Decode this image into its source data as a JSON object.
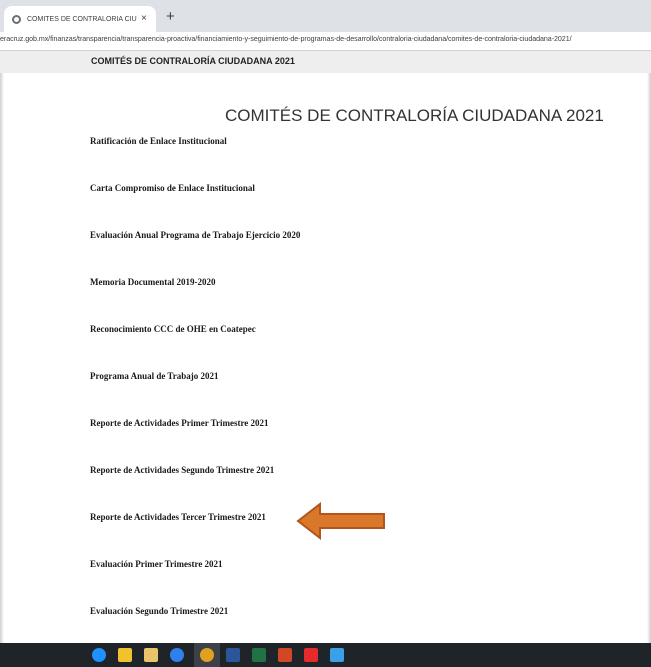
{
  "browser": {
    "tab_title": "COMITÉS DE CONTRALORÍA CIU",
    "tab_close": "×",
    "new_tab": "+",
    "url": "eracruz.gob.mx/finanzas/transparencia/transparencia-proactiva/financiamiento-y-seguimiento-de-programas-de-desarrollo/contraloria-ciudadana/comites-de-contraloria-ciudadana-2021/"
  },
  "page": {
    "breadcrumb": "COMITÉS DE CONTRALORÍA CIUDADANA 2021",
    "title": "COMITÉS DE CONTRALORÍA CIUDADANA 2021",
    "documents": [
      "Ratificación de Enlace Institucional",
      "Carta Compromiso de Enlace Institucional",
      "Evaluación Anual Programa de Trabajo Ejercicio 2020",
      "Memoria Documental 2019-2020",
      "Reconocimiento CCC de OHE en Coatepec",
      "Programa Anual de Trabajo 2021",
      "Reporte de Actividades Primer Trimestre 2021",
      "Reporte de Actividades Segundo Trimestre 2021",
      "Reporte de Actividades Tercer Trimestre 2021",
      "Evaluación Primer Trimestre 2021",
      "Evaluación Segundo Trimestre 2021"
    ],
    "highlighted_document_index": 8
  },
  "colors": {
    "arrow_fill": "#d9782b",
    "arrow_stroke": "#b4541a",
    "taskbar": "#1f2428"
  },
  "taskbar": {
    "left_stub": "Y",
    "apps": [
      {
        "icon": "cortana-icon",
        "color": "#1e90ff"
      },
      {
        "icon": "file-explorer-icon",
        "color": "#f2c12e"
      },
      {
        "icon": "mail-icon",
        "color": "#e9c46a"
      },
      {
        "icon": "internet-explorer-icon",
        "color": "#2f80ed"
      },
      {
        "icon": "chrome-icon",
        "color": "#e0a020"
      },
      {
        "icon": "word-icon",
        "color": "#2b579a"
      },
      {
        "icon": "excel-icon",
        "color": "#217346"
      },
      {
        "icon": "powerpoint-icon",
        "color": "#d24726"
      },
      {
        "icon": "acrobat-icon",
        "color": "#e52b2b"
      },
      {
        "icon": "photos-icon",
        "color": "#3aa0e8"
      }
    ]
  }
}
